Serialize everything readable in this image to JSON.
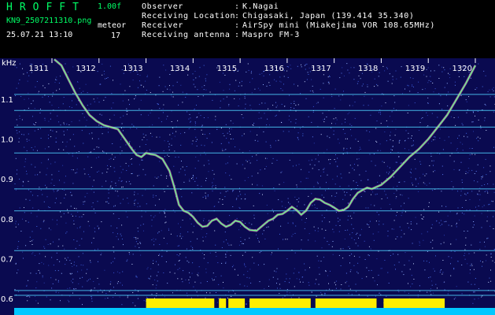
{
  "header": {
    "software": "HROFFT",
    "version": "1.00f",
    "filename": "KN9_2507211310.png",
    "datetime": "25.07.21 13:10",
    "meteor_label": "meteor",
    "meteor_count": "17",
    "fields": [
      {
        "label": "Observer",
        "sep": ":",
        "value": "K.Nagai"
      },
      {
        "label": "Receiving Location",
        "sep": ":",
        "value": "Chigasaki, Japan (139.414 35.340)"
      },
      {
        "label": "Receiver",
        "sep": ":",
        "value": "AirSpy mini (Miakejima VOR 108.65MHz)"
      },
      {
        "label": "Receiving antenna",
        "sep": ":",
        "value": "Maspro FM-3"
      }
    ]
  },
  "colors": {
    "background": "#000000",
    "plot_bg": "#0a0a50",
    "text_green": "#00ff66",
    "horizontal_lines": "#4fd2ff",
    "bottom_band": "#00c8ff",
    "meteor_band": "#ffee00"
  },
  "chart_data": {
    "type": "heatmap",
    "ylabel": "kHz",
    "x_ticks": [
      "1311",
      "1312",
      "1313",
      "1314",
      "1315",
      "1316",
      "1317",
      "1318",
      "1319",
      "1320"
    ],
    "x_range": [
      1311,
      1320
    ],
    "y_ticks": [
      1.1,
      1.0,
      0.9,
      0.8,
      0.7,
      0.6
    ],
    "y_tick_labels": [
      "1.1",
      "1.0",
      "0.9",
      "0.8",
      "0.7",
      "0.6"
    ],
    "y_range": [
      0.56,
      1.2
    ],
    "horizontal_lines_khz": [
      1.112,
      1.072,
      1.03,
      0.965,
      0.875,
      0.82,
      0.72,
      0.62,
      0.608
    ],
    "trace": {
      "x": [
        1311.05,
        1311.2,
        1311.35,
        1311.5,
        1311.65,
        1311.8,
        1311.95,
        1312.1,
        1312.25,
        1312.4,
        1312.55,
        1312.7,
        1312.8,
        1312.9,
        1313.0,
        1313.1,
        1313.2,
        1313.35,
        1313.5,
        1313.6,
        1313.7,
        1313.8,
        1313.9,
        1314.0,
        1314.1,
        1314.2,
        1314.3,
        1314.4,
        1314.5,
        1314.6,
        1314.7,
        1314.8,
        1314.9,
        1315.0,
        1315.1,
        1315.2,
        1315.35,
        1315.5,
        1315.6,
        1315.7,
        1315.8,
        1315.9,
        1316.0,
        1316.1,
        1316.2,
        1316.3,
        1316.4,
        1316.5,
        1316.6,
        1316.7,
        1316.8,
        1316.9,
        1317.0,
        1317.1,
        1317.2,
        1317.3,
        1317.4,
        1317.5,
        1317.6,
        1317.7,
        1317.8,
        1317.9,
        1318.0,
        1318.2,
        1318.4,
        1318.6,
        1318.8,
        1319.0,
        1319.2,
        1319.4,
        1319.6,
        1319.8,
        1320.0
      ],
      "y": [
        1.2,
        1.185,
        1.15,
        1.115,
        1.085,
        1.06,
        1.045,
        1.035,
        1.03,
        1.025,
        1.0,
        0.975,
        0.96,
        0.955,
        0.965,
        0.962,
        0.96,
        0.95,
        0.92,
        0.88,
        0.835,
        0.82,
        0.815,
        0.805,
        0.79,
        0.78,
        0.782,
        0.795,
        0.8,
        0.788,
        0.78,
        0.785,
        0.795,
        0.792,
        0.78,
        0.772,
        0.77,
        0.785,
        0.795,
        0.8,
        0.81,
        0.812,
        0.82,
        0.83,
        0.822,
        0.81,
        0.82,
        0.84,
        0.85,
        0.848,
        0.84,
        0.835,
        0.828,
        0.82,
        0.822,
        0.83,
        0.85,
        0.865,
        0.872,
        0.878,
        0.875,
        0.88,
        0.885,
        0.905,
        0.93,
        0.955,
        0.975,
        1.0,
        1.03,
        1.06,
        1.1,
        1.14,
        1.185
      ]
    },
    "meteor_band_khz": [
      0.578,
      0.6
    ],
    "meteor_band_x": [
      [
        1313.0,
        1314.45
      ],
      [
        1314.55,
        1314.7
      ],
      [
        1314.75,
        1315.1
      ],
      [
        1315.2,
        1316.5
      ],
      [
        1316.6,
        1317.9
      ],
      [
        1318.05,
        1319.35
      ]
    ]
  }
}
